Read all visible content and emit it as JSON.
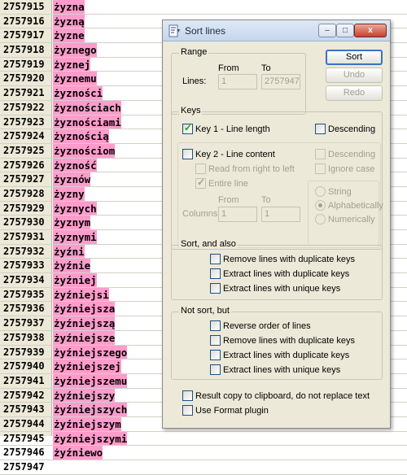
{
  "editor": {
    "lines": [
      {
        "num": "2757915",
        "text": "żyzna"
      },
      {
        "num": "2757916",
        "text": "żyzną"
      },
      {
        "num": "2757917",
        "text": "żyzne"
      },
      {
        "num": "2757918",
        "text": "żyznego"
      },
      {
        "num": "2757919",
        "text": "żyznej"
      },
      {
        "num": "2757920",
        "text": "żyznemu"
      },
      {
        "num": "2757921",
        "text": "żyzności"
      },
      {
        "num": "2757922",
        "text": "żyznościach"
      },
      {
        "num": "2757923",
        "text": "żyznościami"
      },
      {
        "num": "2757924",
        "text": "żyznością"
      },
      {
        "num": "2757925",
        "text": "żyznościom"
      },
      {
        "num": "2757926",
        "text": "żyzność"
      },
      {
        "num": "2757927",
        "text": "żyznów"
      },
      {
        "num": "2757928",
        "text": "żyzny"
      },
      {
        "num": "2757929",
        "text": "żyznych"
      },
      {
        "num": "2757930",
        "text": "żyznym"
      },
      {
        "num": "2757931",
        "text": "żyznymi"
      },
      {
        "num": "2757932",
        "text": "żyźni"
      },
      {
        "num": "2757933",
        "text": "żyźnie"
      },
      {
        "num": "2757934",
        "text": "żyźniej"
      },
      {
        "num": "2757935",
        "text": "żyźniejsi"
      },
      {
        "num": "2757936",
        "text": "żyźniejsza"
      },
      {
        "num": "2757937",
        "text": "żyźniejszą"
      },
      {
        "num": "2757938",
        "text": "żyźniejsze"
      },
      {
        "num": "2757939",
        "text": "żyźniejszego"
      },
      {
        "num": "2757940",
        "text": "żyźniejszej"
      },
      {
        "num": "2757941",
        "text": "żyźniejszemu"
      },
      {
        "num": "2757942",
        "text": "żyźniejszy"
      },
      {
        "num": "2757943",
        "text": "żyźniejszych"
      },
      {
        "num": "2757944",
        "text": "żyźniejszym"
      },
      {
        "num": "2757945",
        "text": "żyźniejszymi"
      },
      {
        "num": "2757946",
        "text": "żyźniewo"
      },
      {
        "num": "2757947",
        "text": ""
      }
    ],
    "highlight_color": "#ff9ccc"
  },
  "dialog": {
    "title": "Sort lines",
    "title_icon": "sort-lines-icon",
    "window_buttons": {
      "minimize": "–",
      "maximize": "□",
      "close": "x"
    },
    "range": {
      "group_label": "Range",
      "lines_label": "Lines:",
      "from_label": "From",
      "to_label": "To",
      "from_value": "1",
      "to_value": "2757947"
    },
    "buttons": {
      "sort": "Sort",
      "undo": "Undo",
      "redo": "Redo"
    },
    "keys": {
      "group_label": "Keys",
      "key1_label": "Key 1 - Line length",
      "key1_checked": true,
      "key1_descending": "Descending",
      "key2_label": "Key 2 - Line content",
      "key2_descending": "Descending",
      "ignore_case": "Ignore case",
      "read_rtl": "Read from right to left",
      "entire_line": "Entire line",
      "entire_line_checked": true,
      "columns_label": "Columns:",
      "col_from_label": "From",
      "col_to_label": "To",
      "col_from_value": "1",
      "col_to_value": "1",
      "radio_string": "String",
      "radio_alpha": "Alphabetically",
      "radio_num": "Numerically",
      "radio_selected": "Alphabetically"
    },
    "sort_also": {
      "group_label": "Sort, and also",
      "options": [
        "Remove lines with duplicate keys",
        "Extract lines with duplicate keys",
        "Extract lines with unique keys"
      ]
    },
    "not_sort": {
      "group_label": "Not sort, but",
      "options": [
        "Reverse order of lines",
        "Remove lines with duplicate keys",
        "Extract lines with duplicate keys",
        "Extract lines with unique keys"
      ]
    },
    "result_copy": "Result copy to clipboard, do not replace text",
    "use_format_plugin": "Use Format plugin"
  }
}
